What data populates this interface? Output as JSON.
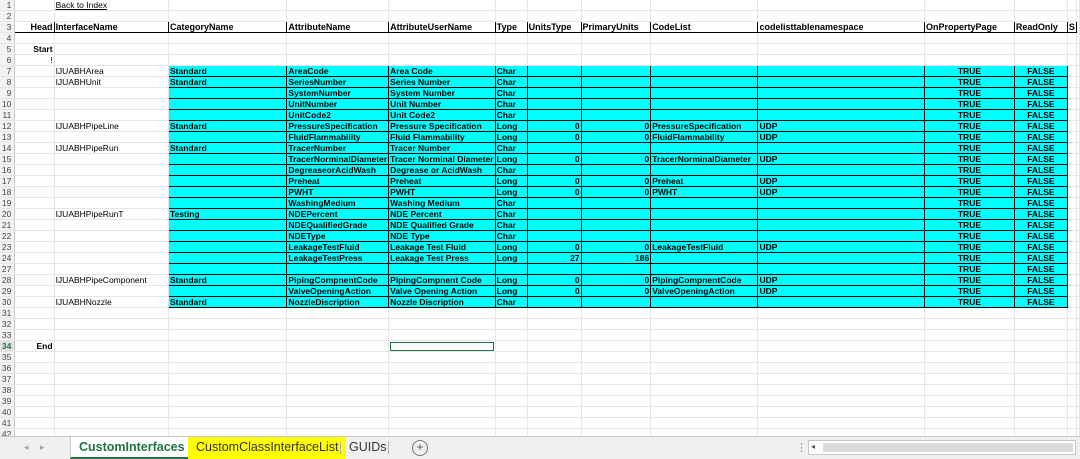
{
  "sheet": {
    "rows": [
      {
        "n": "1",
        "cells": {
          "B": "Back to Index"
        }
      },
      {
        "n": "2",
        "cells": {}
      },
      {
        "n": "3",
        "cells": {
          "A": "Head",
          "B": "InterfaceName",
          "C": "CategoryName",
          "D": "AttributeName",
          "E": "AttributeUserName",
          "F": "Type",
          "G": "UnitsType",
          "H": "PrimaryUnits",
          "I": "CodeList",
          "J": "codelisttablenamespace",
          "K": "OnPropertyPage",
          "L": "ReadOnly",
          "M": "S"
        }
      },
      {
        "n": "4",
        "cells": {}
      },
      {
        "n": "5",
        "cells": {
          "A": "Start"
        }
      },
      {
        "n": "6",
        "cells": {
          "A": "!"
        }
      },
      {
        "n": "7",
        "cells": {
          "B": "IJUABHArea",
          "C": "Standard",
          "D": "AreaCode",
          "E": "Area Code",
          "F": "Char",
          "K": "TRUE",
          "L": "FALSE"
        }
      },
      {
        "n": "8",
        "cells": {
          "B": "IJUABHUnit",
          "C": "Standard",
          "D": "SeriesNumber",
          "E": "Series Number",
          "F": "Char",
          "K": "TRUE",
          "L": "FALSE"
        }
      },
      {
        "n": "9",
        "cells": {
          "D": "SystemNumber",
          "E": "System Number",
          "F": "Char",
          "K": "TRUE",
          "L": "FALSE"
        }
      },
      {
        "n": "10",
        "cells": {
          "D": "UnitNumber",
          "E": "Unit Number",
          "F": "Char",
          "K": "TRUE",
          "L": "FALSE"
        }
      },
      {
        "n": "11",
        "cells": {
          "D": "UnitCode2",
          "E": "Unit Code2",
          "F": "Char",
          "K": "TRUE",
          "L": "FALSE"
        }
      },
      {
        "n": "12",
        "cells": {
          "B": "IJUABHPipeLine",
          "C": "Standard",
          "D": "PressureSpecification",
          "E": "Pressure Specification",
          "F": "Long",
          "G": "0",
          "H": "0",
          "I": "PressureSpecification",
          "J": "UDP",
          "K": "TRUE",
          "L": "FALSE"
        }
      },
      {
        "n": "13",
        "cells": {
          "D": "FluidFlammability",
          "E": "Fluid Flammability",
          "F": "Long",
          "G": "0",
          "H": "0",
          "I": "FluidFlammability",
          "J": "UDP",
          "K": "TRUE",
          "L": "FALSE"
        }
      },
      {
        "n": "14",
        "cells": {
          "B": "IJUABHPipeRun",
          "C": "Standard",
          "D": "TracerNumber",
          "E": "Tracer Number",
          "F": "Char",
          "K": "TRUE",
          "L": "FALSE"
        }
      },
      {
        "n": "15",
        "cells": {
          "D": "TracerNorminalDiameter",
          "E": "Tracer Norminal Diameter",
          "F": "Long",
          "G": "0",
          "H": "0",
          "I": "TracerNorminalDiameter",
          "J": "UDP",
          "K": "TRUE",
          "L": "FALSE"
        }
      },
      {
        "n": "16",
        "cells": {
          "D": "DegreaseorAcidWash",
          "E": "Degrease or AcidWash",
          "F": "Char",
          "K": "TRUE",
          "L": "FALSE"
        }
      },
      {
        "n": "17",
        "cells": {
          "D": "Preheat",
          "E": "Preheat",
          "F": "Long",
          "G": "0",
          "H": "0",
          "I": "Preheat",
          "J": "UDP",
          "K": "TRUE",
          "L": "FALSE"
        }
      },
      {
        "n": "18",
        "cells": {
          "D": "PWHT",
          "E": "PWHT",
          "F": "Long",
          "G": "0",
          "H": "0",
          "I": "PWHT",
          "J": "UDP",
          "K": "TRUE",
          "L": "FALSE"
        }
      },
      {
        "n": "19",
        "cells": {
          "D": "WashingMedium",
          "E": "Washing Medium",
          "F": "Char",
          "K": "TRUE",
          "L": "FALSE"
        }
      },
      {
        "n": "20",
        "cells": {
          "B": "IJUABHPipeRunT",
          "C": "Testing",
          "D": "NDEPercent",
          "E": "NDE Percent",
          "F": "Char",
          "K": "TRUE",
          "L": "FALSE"
        }
      },
      {
        "n": "21",
        "cells": {
          "D": "NDEQualifiedGrade",
          "E": "NDE Qualified Grade",
          "F": "Char",
          "K": "TRUE",
          "L": "FALSE"
        }
      },
      {
        "n": "22",
        "cells": {
          "D": "NDEType",
          "E": "NDE Type",
          "F": "Char",
          "K": "TRUE",
          "L": "FALSE"
        }
      },
      {
        "n": "23",
        "cells": {
          "D": "LeakageTestFluid",
          "E": "Leakage Test Fluid",
          "F": "Long",
          "G": "0",
          "H": "0",
          "I": "LeakageTestFluid",
          "J": "UDP",
          "K": "TRUE",
          "L": "FALSE"
        }
      },
      {
        "n": "24",
        "cells": {
          "D": "LeakageTestPress",
          "E": "Leakage Test Press",
          "F": "Long",
          "G": "27",
          "H": "186",
          "K": "TRUE",
          "L": "FALSE"
        }
      },
      {
        "n": "27",
        "cells": {
          "K": "TRUE",
          "L": "FALSE"
        }
      },
      {
        "n": "28",
        "cells": {
          "B": "IJUABHPipeComponent",
          "C": "Standard",
          "D": "PipingCompnentCode",
          "E": "PipingCompnent Code",
          "F": "Long",
          "G": "0",
          "H": "0",
          "I": "PipingCompnentCode",
          "J": "UDP",
          "K": "TRUE",
          "L": "FALSE"
        }
      },
      {
        "n": "29",
        "cells": {
          "D": "ValveOpeningAction",
          "E": "Valve Opening Action",
          "F": "Long",
          "G": "0",
          "H": "0",
          "I": "ValveOpeningAction",
          "J": "UDP",
          "K": "TRUE",
          "L": "FALSE"
        }
      },
      {
        "n": "30",
        "cells": {
          "B": "IJUABHNozzle",
          "C": "Standard",
          "D": "NozzleDiscription",
          "E": "Nozzle Discription",
          "F": "Char",
          "K": "TRUE",
          "L": "FALSE"
        }
      },
      {
        "n": "31",
        "cells": {}
      },
      {
        "n": "32",
        "cells": {}
      },
      {
        "n": "33",
        "cells": {}
      },
      {
        "n": "34",
        "cells": {
          "A": "End"
        }
      },
      {
        "n": "35",
        "cells": {}
      },
      {
        "n": "36",
        "cells": {}
      },
      {
        "n": "37",
        "cells": {}
      },
      {
        "n": "38",
        "cells": {}
      },
      {
        "n": "39",
        "cells": {}
      },
      {
        "n": "40",
        "cells": {}
      },
      {
        "n": "41",
        "cells": {}
      },
      {
        "n": "42",
        "cells": {}
      },
      {
        "n": "43",
        "cells": {}
      }
    ]
  },
  "tabs": {
    "prev_icon": "◂",
    "next_icon": "▸",
    "items": [
      {
        "label": "CustomInterfaces"
      },
      {
        "label": "CustomClassInterfaceList"
      },
      {
        "label": "GUIDs"
      }
    ],
    "add_icon": "+",
    "split_icon": "⋮",
    "scroll_left_icon": "◂"
  },
  "colors": {
    "cyan_fill": "#00ffff",
    "yellow_tab": "#ffff00",
    "accent": "#217346"
  }
}
